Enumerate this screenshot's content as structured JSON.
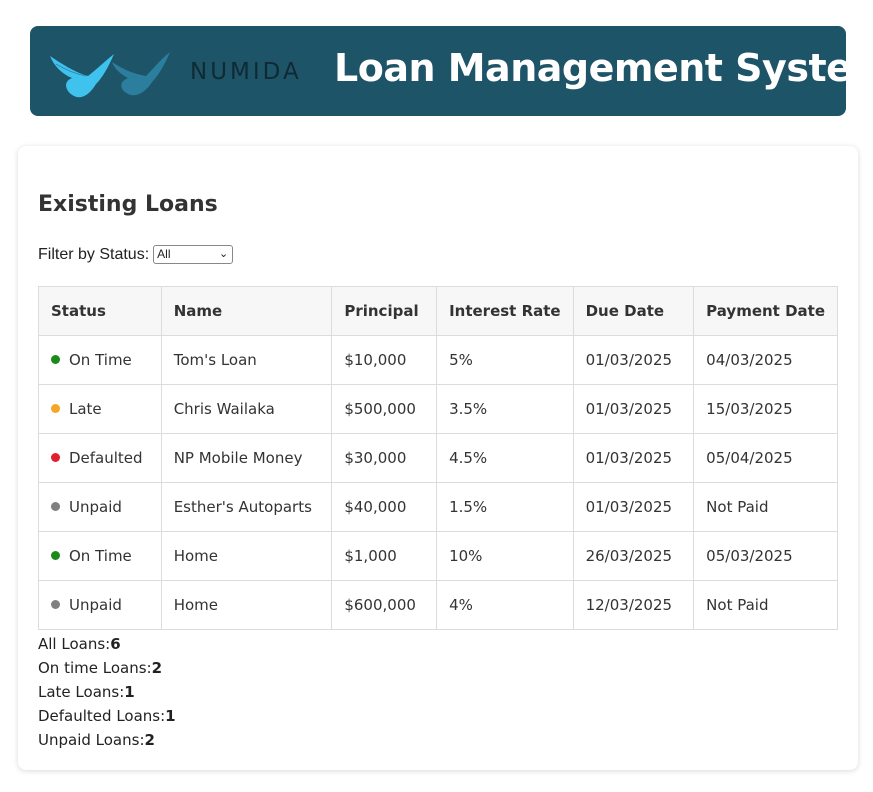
{
  "header": {
    "logo_text": "NUMIDA",
    "title": "Loan Management System",
    "bg_color": "#1e5468"
  },
  "main": {
    "section_title": "Existing Loans",
    "filter": {
      "label": "Filter by Status:",
      "selected": "All"
    },
    "table": {
      "columns": [
        "Status",
        "Name",
        "Principal",
        "Interest Rate",
        "Due Date",
        "Payment Date"
      ],
      "rows": [
        {
          "status": "On Time",
          "status_color": "#1a8a1a",
          "name": "Tom's Loan",
          "principal": "$10,000",
          "interest": "5%",
          "due": "01/03/2025",
          "payment": "04/03/2025"
        },
        {
          "status": "Late",
          "status_color": "#f5a623",
          "name": "Chris Wailaka",
          "principal": "$500,000",
          "interest": "3.5%",
          "due": "01/03/2025",
          "payment": "15/03/2025"
        },
        {
          "status": "Defaulted",
          "status_color": "#e0202e",
          "name": "NP Mobile Money",
          "principal": "$30,000",
          "interest": "4.5%",
          "due": "01/03/2025",
          "payment": "05/04/2025"
        },
        {
          "status": "Unpaid",
          "status_color": "#808080",
          "name": "Esther's Autoparts",
          "principal": "$40,000",
          "interest": "1.5%",
          "due": "01/03/2025",
          "payment": "Not Paid"
        },
        {
          "status": "On Time",
          "status_color": "#1a8a1a",
          "name": "Home",
          "principal": "$1,000",
          "interest": "10%",
          "due": "26/03/2025",
          "payment": "05/03/2025"
        },
        {
          "status": "Unpaid",
          "status_color": "#808080",
          "name": "Home",
          "principal": "$600,000",
          "interest": "4%",
          "due": "12/03/2025",
          "payment": "Not Paid"
        }
      ]
    },
    "summary": [
      {
        "label": "All Loans:",
        "value": "6"
      },
      {
        "label": "On time Loans:",
        "value": "2"
      },
      {
        "label": "Late Loans:",
        "value": "1"
      },
      {
        "label": "Defaulted Loans:",
        "value": "1"
      },
      {
        "label": "Unpaid Loans:",
        "value": "2"
      }
    ]
  }
}
